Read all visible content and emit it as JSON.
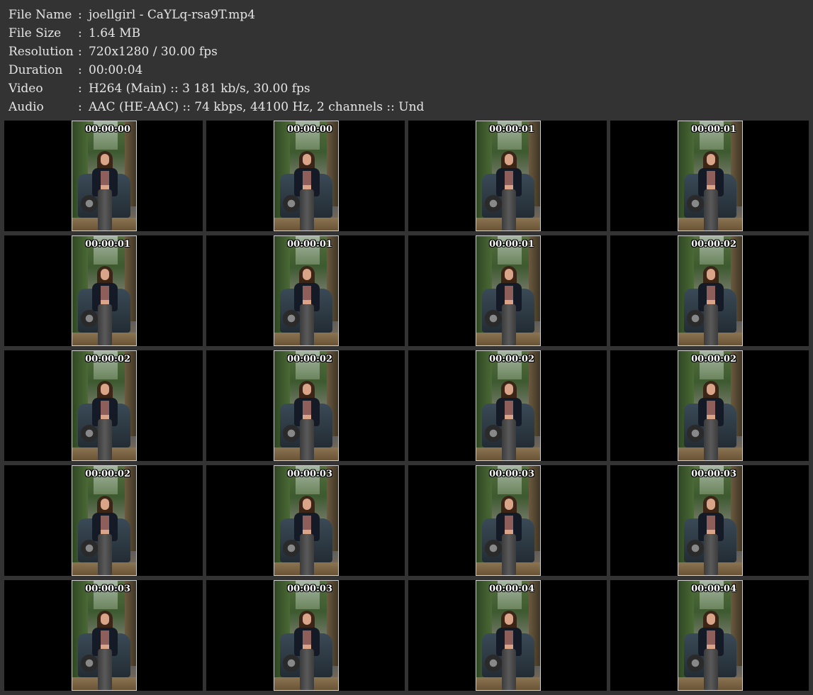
{
  "info": [
    {
      "label": "File Name",
      "value": "joellgirl - CaYLq-rsa9T.mp4"
    },
    {
      "label": "File Size",
      "value": "1.64 MB"
    },
    {
      "label": "Resolution",
      "value": "720x1280 / 30.00 fps"
    },
    {
      "label": "Duration",
      "value": "00:00:04"
    },
    {
      "label": "Video",
      "value": "H264 (Main) :: 3 181 kb/s, 30.00 fps"
    },
    {
      "label": "Audio",
      "value": "AAC (HE-AAC) :: 74 kbps, 44100 Hz, 2 channels :: Und"
    }
  ],
  "separator": ":",
  "thumbnails": [
    "00:00:00",
    "00:00:00",
    "00:00:01",
    "00:00:01",
    "00:00:01",
    "00:00:01",
    "00:00:01",
    "00:00:02",
    "00:00:02",
    "00:00:02",
    "00:00:02",
    "00:00:02",
    "00:00:02",
    "00:00:03",
    "00:00:03",
    "00:00:03",
    "00:00:03",
    "00:00:03",
    "00:00:04",
    "00:00:04"
  ]
}
